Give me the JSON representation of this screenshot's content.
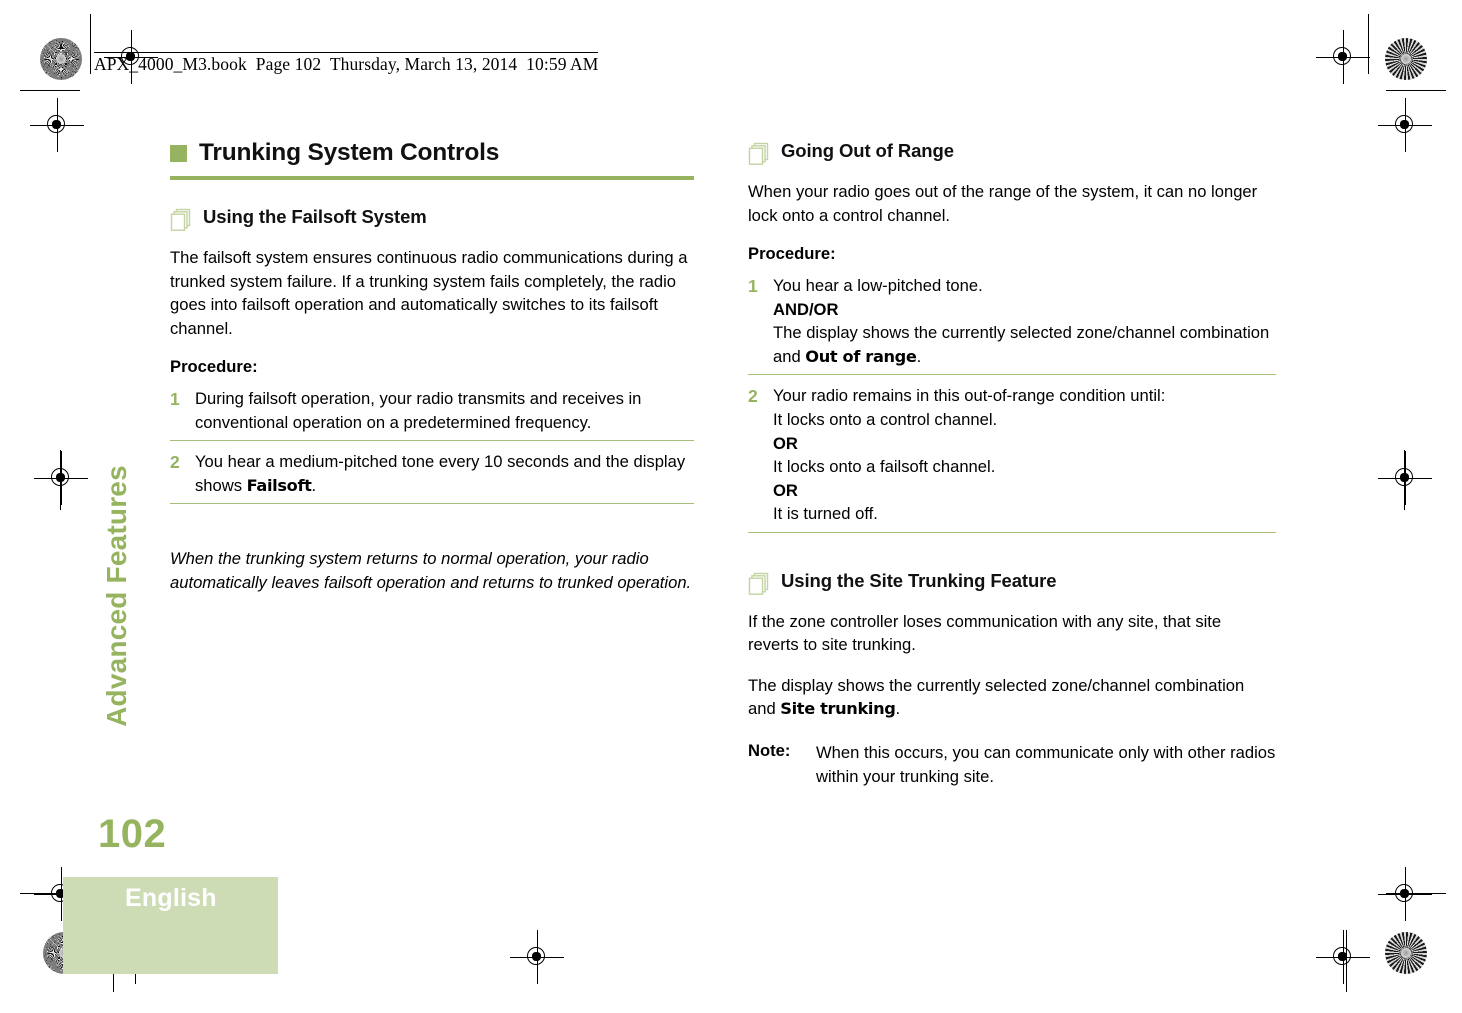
{
  "running_head": {
    "file": "APX_4000_M3.book",
    "page": "Page 102",
    "timestamp": "Thursday, March 13, 2014  10:59 AM",
    "full": "APX_4000_M3.book  Page 102  Thursday, March 13, 2014  10:59 AM"
  },
  "sidebar": {
    "chapter_label": "Advanced Features",
    "page_number": "102",
    "language": "English"
  },
  "colors": {
    "accent_green": "#96b45f",
    "rule_green": "#a8c077",
    "light_green_block": "#cddcb4",
    "icon_green": "#c3d4a2",
    "text_black": "#000000"
  },
  "left_column": {
    "chapter_title": "Trunking System Controls",
    "section": {
      "title": "Using the Failsoft System",
      "intro": "The failsoft system ensures continuous radio communications during a trunked system failure. If a trunking system fails completely, the radio goes into failsoft operation and automatically switches to its failsoft channel.",
      "procedure_label": "Procedure:",
      "steps": [
        {
          "number": "1",
          "text": "During failsoft operation, your radio transmits and receives in conventional operation on a predetermined frequency."
        },
        {
          "number": "2",
          "text_before": "You hear a medium-pitched tone every 10 seconds and the display shows ",
          "display_text": "Failsoft",
          "text_after": "."
        }
      ],
      "closing_italic": "When the trunking system returns to normal operation, your radio automatically leaves failsoft operation and returns to trunked operation."
    }
  },
  "right_column": {
    "sections": [
      {
        "title": "Going Out of Range",
        "intro": "When your radio goes out of the range of the system, it can no longer lock onto a control channel.",
        "procedure_label": "Procedure:",
        "steps": [
          {
            "number": "1",
            "line1": "You hear a low-pitched tone.",
            "conjunction": "AND/OR",
            "line2_before": "The display shows the currently selected zone/channel combination and ",
            "display_text": "Out of range",
            "line2_after": "."
          },
          {
            "number": "2",
            "line1": "Your radio remains in this out-of-range condition until:",
            "line2": "It locks onto a control channel.",
            "or1": "OR",
            "line3": "It locks onto a failsoft channel.",
            "or2": "OR",
            "line4": "It is turned off."
          }
        ]
      },
      {
        "title": "Using the Site Trunking Feature",
        "intro": "If the zone controller loses communication with any site, that site reverts to site trunking.",
        "paragraph2_before": "The display shows the currently selected zone/channel combination and ",
        "paragraph2_display": "Site trunking",
        "paragraph2_after": ".",
        "note_label": "Note:",
        "note_text": "When this occurs, you can communicate only with other radios within your trunking site."
      }
    ]
  }
}
